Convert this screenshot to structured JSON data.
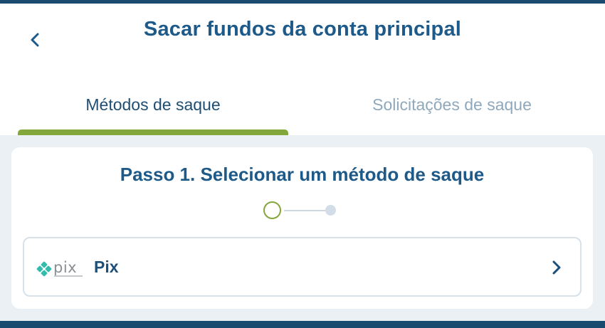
{
  "header": {
    "title": "Sacar fundos da conta principal",
    "back_icon": "chevron-left-icon"
  },
  "tabs": [
    {
      "label": "Métodos de saque",
      "active": true
    },
    {
      "label": "Solicitações de saque",
      "active": false
    }
  ],
  "step": {
    "title": "Passo 1. Selecionar um método de saque",
    "current": 1,
    "total": 2
  },
  "methods": [
    {
      "logo_text": "pix",
      "label": "Pix",
      "icon": "chevron-right-icon"
    }
  ],
  "colors": {
    "primary": "#1d5a89",
    "accent": "#84a73c",
    "bar": "#1b4a6f",
    "inactive_tab": "#8fa8bb",
    "pix_teal": "#32bcad",
    "background": "#ebf0f4"
  }
}
